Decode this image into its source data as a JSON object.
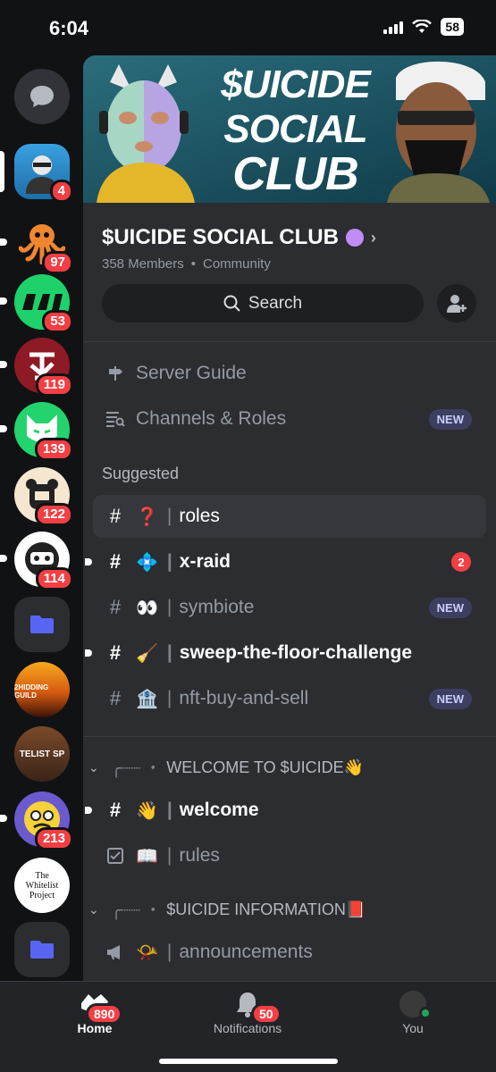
{
  "status": {
    "time": "6:04",
    "battery": "58"
  },
  "servers": [
    {
      "id": "dm",
      "badge": ""
    },
    {
      "id": "suicide-social-club",
      "badge": "4"
    },
    {
      "id": "octopus",
      "badge": "97"
    },
    {
      "id": "pawa",
      "badge": "53"
    },
    {
      "id": "kanji",
      "badge": "119"
    },
    {
      "id": "green-cat",
      "badge": "139"
    },
    {
      "id": "bear",
      "badge": "122"
    },
    {
      "id": "robot",
      "badge": "114"
    },
    {
      "id": "folder-1",
      "badge": ""
    },
    {
      "id": "guild",
      "label": "2HIDDING GUILD",
      "badge": ""
    },
    {
      "id": "telist",
      "label": "TELIST SP",
      "badge": ""
    },
    {
      "id": "cartoon",
      "badge": "213"
    },
    {
      "id": "whitelist",
      "label": "The Whitelist Project",
      "badge": ""
    },
    {
      "id": "folder-2",
      "badge": ""
    }
  ],
  "banner": {
    "line1": "$UICIDE",
    "line2": "SOCIAL",
    "line3": "CLUB"
  },
  "server": {
    "name": "$UICIDE SOCIAL CLUB",
    "members": "358 Members",
    "type": "Community",
    "search_label": "Search"
  },
  "top_links": [
    {
      "label": "Server Guide"
    },
    {
      "label": "Channels & Roles",
      "tag": "NEW"
    }
  ],
  "suggested_label": "Suggested",
  "suggested": [
    {
      "emoji": "❓",
      "name": "roles",
      "selected": true
    },
    {
      "emoji": "💠",
      "name": "x-raid",
      "unread": true,
      "count": "2"
    },
    {
      "emoji": "👀",
      "name": "symbiote",
      "tag": "NEW"
    },
    {
      "emoji": "🧹",
      "name": "sweep-the-floor-challenge",
      "unread": true
    },
    {
      "emoji": "🏦",
      "name": "nft-buy-and-sell",
      "tag": "NEW"
    }
  ],
  "categories": [
    {
      "prefix": "╭┈┈ ・",
      "name": "WELCOME TO $UICIDE👋",
      "channels": [
        {
          "emoji": "👋",
          "name": "welcome",
          "unread": true
        },
        {
          "emoji": "📖",
          "name": "rules"
        }
      ]
    },
    {
      "prefix": "╭┈┈ ・",
      "name": "$UICIDE INFORMATION📕",
      "channels": [
        {
          "emoji": "📯",
          "name": "announcements"
        }
      ]
    }
  ],
  "nav": {
    "home": {
      "label": "Home",
      "badge": "890"
    },
    "notifications": {
      "label": "Notifications",
      "badge": "50"
    },
    "you": {
      "label": "You"
    }
  },
  "colors": {
    "accent": "#5865f2",
    "badge": "#f23f43",
    "panel": "#2b2d31",
    "rail": "#111214"
  }
}
